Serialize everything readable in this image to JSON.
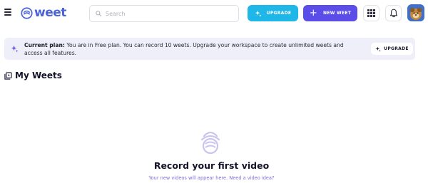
{
  "header": {
    "logo_text": "weet",
    "search_placeholder": "Search",
    "search_value": "",
    "upgrade_label": "UPGRADE",
    "new_weet_label": "NEW WEET"
  },
  "banner": {
    "plan_label": "Current plan:",
    "plan_text": "You are in Free plan. You can record 10 weets. Upgrade your workspace to create unlimited weets and access all features.",
    "upgrade_label": "UPGRADE"
  },
  "main": {
    "section_title": "My Weets",
    "empty_title": "Record your first video",
    "empty_subtitle": "Your new videos will appear here. Need a video idea?"
  },
  "colors": {
    "brand": "#4a63d8",
    "upgrade_button": "#1fb6e8",
    "new_weet_button": "#5b4ee8",
    "banner_bg": "#eeeff8",
    "link_text": "#7b6fd8"
  },
  "icons": [
    "menu-icon",
    "weet-logo-icon",
    "search-icon",
    "sparkle-icon",
    "plus-icon",
    "apps-grid-icon",
    "bell-icon",
    "avatar",
    "video-library-icon",
    "empty-state-icon"
  ]
}
